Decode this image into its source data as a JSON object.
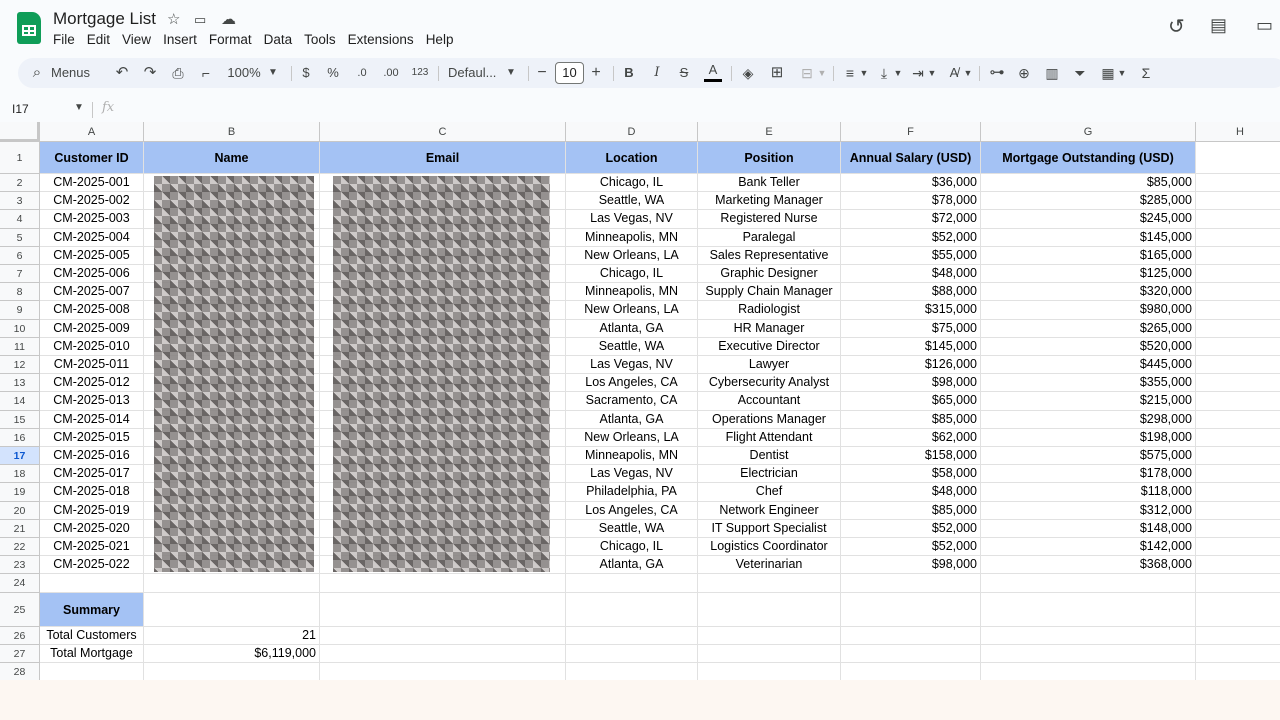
{
  "app": {
    "title": "Mortgage List",
    "menu": [
      "File",
      "Edit",
      "View",
      "Insert",
      "Format",
      "Data",
      "Tools",
      "Extensions",
      "Help"
    ]
  },
  "toolbar": {
    "search_label": "Menus",
    "zoom": "100%",
    "currency": "$",
    "percent": "%",
    "dec_decrease": ".0",
    "dec_increase": ".00",
    "number_format": "123",
    "font": "Defaul...",
    "font_size": "10",
    "bold": "B",
    "italic": "I",
    "strike": "S",
    "text_color_label": "A",
    "text_color": "#000000"
  },
  "formula_bar": {
    "cell_ref": "I17",
    "fx": "fx",
    "value": ""
  },
  "columns": [
    "A",
    "B",
    "C",
    "D",
    "E",
    "F",
    "G",
    "H"
  ],
  "headers": [
    "Customer ID",
    "Name",
    "Email",
    "Location",
    "Position",
    "Annual Salary (USD)",
    "Mortgage Outstanding (USD)"
  ],
  "rows": [
    [
      "CM-2025-001",
      "Chicago, IL",
      "Bank Teller",
      "$36,000",
      "$85,000"
    ],
    [
      "CM-2025-002",
      "Seattle, WA",
      "Marketing Manager",
      "$78,000",
      "$285,000"
    ],
    [
      "CM-2025-003",
      "Las Vegas, NV",
      "Registered Nurse",
      "$72,000",
      "$245,000"
    ],
    [
      "CM-2025-004",
      "Minneapolis, MN",
      "Paralegal",
      "$52,000",
      "$145,000"
    ],
    [
      "CM-2025-005",
      "New Orleans, LA",
      "Sales Representative",
      "$55,000",
      "$165,000"
    ],
    [
      "CM-2025-006",
      "Chicago, IL",
      "Graphic Designer",
      "$48,000",
      "$125,000"
    ],
    [
      "CM-2025-007",
      "Minneapolis, MN",
      "Supply Chain Manager",
      "$88,000",
      "$320,000"
    ],
    [
      "CM-2025-008",
      "New Orleans, LA",
      "Radiologist",
      "$315,000",
      "$980,000"
    ],
    [
      "CM-2025-009",
      "Atlanta, GA",
      "HR Manager",
      "$75,000",
      "$265,000"
    ],
    [
      "CM-2025-010",
      "Seattle, WA",
      "Executive Director",
      "$145,000",
      "$520,000"
    ],
    [
      "CM-2025-011",
      "Las Vegas, NV",
      "Lawyer",
      "$126,000",
      "$445,000"
    ],
    [
      "CM-2025-012",
      "Los Angeles, CA",
      "Cybersecurity Analyst",
      "$98,000",
      "$355,000"
    ],
    [
      "CM-2025-013",
      "Sacramento, CA",
      "Accountant",
      "$65,000",
      "$215,000"
    ],
    [
      "CM-2025-014",
      "Atlanta, GA",
      "Operations Manager",
      "$85,000",
      "$298,000"
    ],
    [
      "CM-2025-015",
      "New Orleans, LA",
      "Flight Attendant",
      "$62,000",
      "$198,000"
    ],
    [
      "CM-2025-016",
      "Minneapolis, MN",
      "Dentist",
      "$158,000",
      "$575,000"
    ],
    [
      "CM-2025-017",
      "Las Vegas, NV",
      "Electrician",
      "$58,000",
      "$178,000"
    ],
    [
      "CM-2025-018",
      "Philadelphia, PA",
      "Chef",
      "$48,000",
      "$118,000"
    ],
    [
      "CM-2025-019",
      "Los Angeles, CA",
      "Network Engineer",
      "$85,000",
      "$312,000"
    ],
    [
      "CM-2025-020",
      "Seattle, WA",
      "IT Support Specialist",
      "$52,000",
      "$148,000"
    ],
    [
      "CM-2025-021",
      "Chicago, IL",
      "Logistics Coordinator",
      "$52,000",
      "$142,000"
    ],
    [
      "CM-2025-022",
      "Atlanta, GA",
      "Veterinarian",
      "$98,000",
      "$368,000"
    ]
  ],
  "summary": {
    "title": "Summary",
    "total_customers_label": "Total Customers",
    "total_customers": "21",
    "total_mortgage_label": "Total Mortgage",
    "total_mortgage": "$6,119,000"
  },
  "active_row": 17,
  "colors": {
    "header_fill": "#a4c2f4",
    "active_row": "#d3e3fd",
    "brand": "#0f9d58"
  }
}
